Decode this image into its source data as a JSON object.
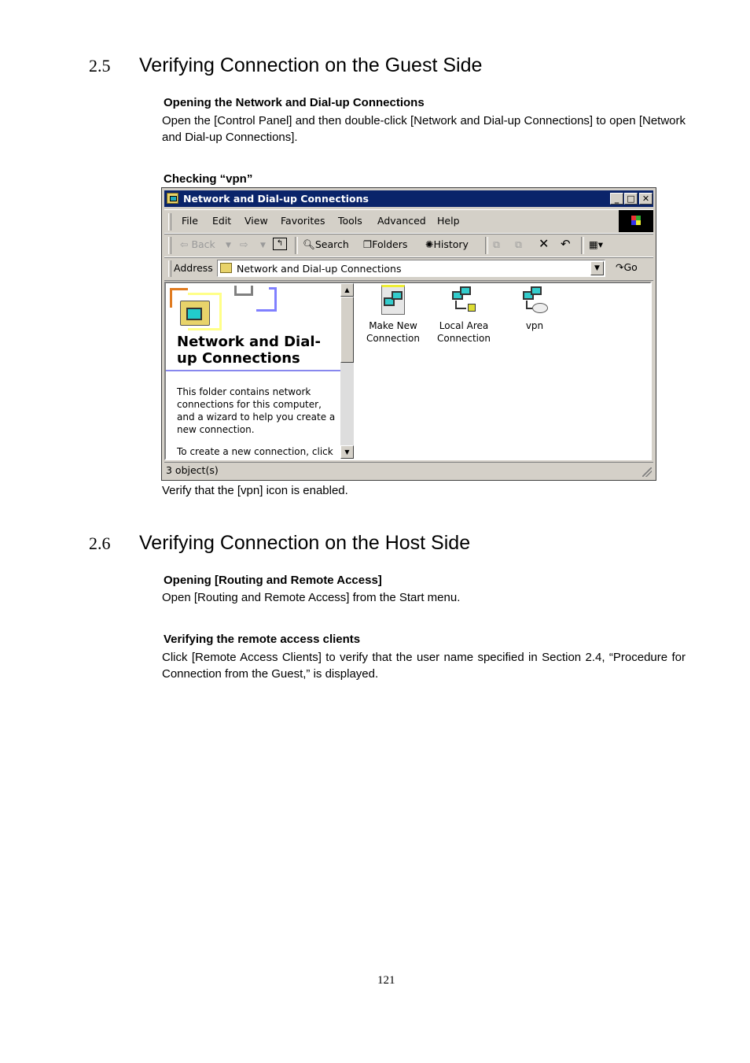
{
  "section_2_5": {
    "number": "2.5",
    "title": "Verifying Connection on the Guest Side",
    "sub1_heading": "Opening the Network and Dial-up Connections",
    "sub1_text": "Open the [Control Panel] and then double-click [Network and Dial-up Connections] to open [Network and Dial-up Connections].",
    "sub2_heading": "Checking “vpn”",
    "caption": "Verify that the [vpn] icon is enabled."
  },
  "window": {
    "title": "Network and Dial-up Connections",
    "controls": {
      "minimize": "_",
      "maximize": "□",
      "close": "✕"
    },
    "menu": [
      "File",
      "Edit",
      "View",
      "Favorites",
      "Tools",
      "Advanced",
      "Help"
    ],
    "toolbar": {
      "back": "⇦ Back",
      "forward": "⇨",
      "up_icon": "folder-up-icon",
      "search": "Search",
      "folders": "Folders",
      "history": "History",
      "move_icon": "move-to-icon",
      "copy_icon": "copy-to-icon",
      "delete": "✕",
      "undo": "↶",
      "views": "▦▾"
    },
    "address": {
      "label": "Address",
      "value": "Network and Dial-up Connections",
      "go": "Go"
    },
    "left_panel": {
      "title": "Network and Dial-up Connections",
      "description": "This folder contains network connections for this computer, and a wizard to help you create a new connection.",
      "more": "To create a new connection, click"
    },
    "items": [
      {
        "label": "Make New Connection",
        "icon": "make-new-connection-icon"
      },
      {
        "label": "Local Area Connection",
        "icon": "local-area-connection-icon"
      },
      {
        "label": "vpn",
        "icon": "vpn-connection-icon"
      }
    ],
    "status": "3 object(s)"
  },
  "section_2_6": {
    "number": "2.6",
    "title": "Verifying Connection on the Host Side",
    "sub1_heading": "Opening [Routing and Remote Access]",
    "sub1_text": "Open [Routing and Remote Access] from the Start menu.",
    "sub2_heading": "Verifying the remote access clients",
    "sub2_text": "Click [Remote Access Clients] to verify that the user name specified in Section 2.4, “Procedure for Connection from the Guest,” is displayed."
  },
  "page_number": "121"
}
